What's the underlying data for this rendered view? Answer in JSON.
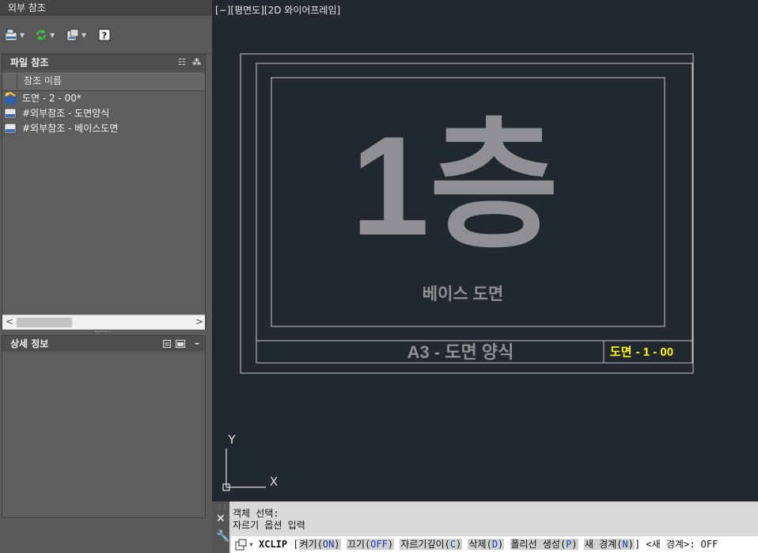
{
  "palette": {
    "title": "외부 참조",
    "toolbar": [
      {
        "name": "attach-dwg-icon",
        "has_dropdown": true
      },
      {
        "name": "refresh-icon",
        "has_dropdown": true
      },
      {
        "name": "change-path-icon",
        "has_dropdown": true
      },
      {
        "name": "help-icon",
        "has_dropdown": false
      }
    ],
    "file_references": {
      "title": "파일 참조",
      "column_header": "참조 이름",
      "items": [
        {
          "label": "도면 - 2 - 00*",
          "icon": "drawing-icon"
        },
        {
          "label": "#외부참조 - 도면양식",
          "icon": "dwg-file-icon"
        },
        {
          "label": "#외부참조 - 베이스도면",
          "icon": "dwg-file-icon"
        }
      ]
    },
    "details": {
      "title": "상세 정보"
    }
  },
  "viewport": {
    "label": "[−][평면도][2D 와이어프레임]"
  },
  "drawing": {
    "big_text": "1층",
    "sub_text": "베이스 도면",
    "title_block_text": "A3 - 도면 양식",
    "title_block_prefix": "A3",
    "title_block_rest": "도면 양식",
    "sheet_number_label": "도면",
    "sheet_number_value": "- 1 - 00",
    "ucs_x": "X",
    "ucs_y": "Y",
    "colors": {
      "background": "#212830",
      "lines": "#c8c8c8",
      "text": "#8e9094",
      "sheet_number": "#ffff00"
    }
  },
  "command": {
    "history": [
      "객체 선택:",
      "자르기 옵션 입력"
    ],
    "prompt_command": "XCLIP",
    "open_bracket": "[",
    "options": [
      {
        "label": "켜기",
        "key": "ON"
      },
      {
        "label": "끄기",
        "key": "OFF"
      },
      {
        "label": "자르기깊이",
        "key": "C"
      },
      {
        "label": "삭제",
        "key": "D"
      },
      {
        "label": "폴리선 생성",
        "key": "P"
      },
      {
        "label": "새 경계",
        "key": "N"
      }
    ],
    "close_bracket": "]",
    "default_prompt": "<새 경계>:",
    "input_value": "OFF"
  }
}
